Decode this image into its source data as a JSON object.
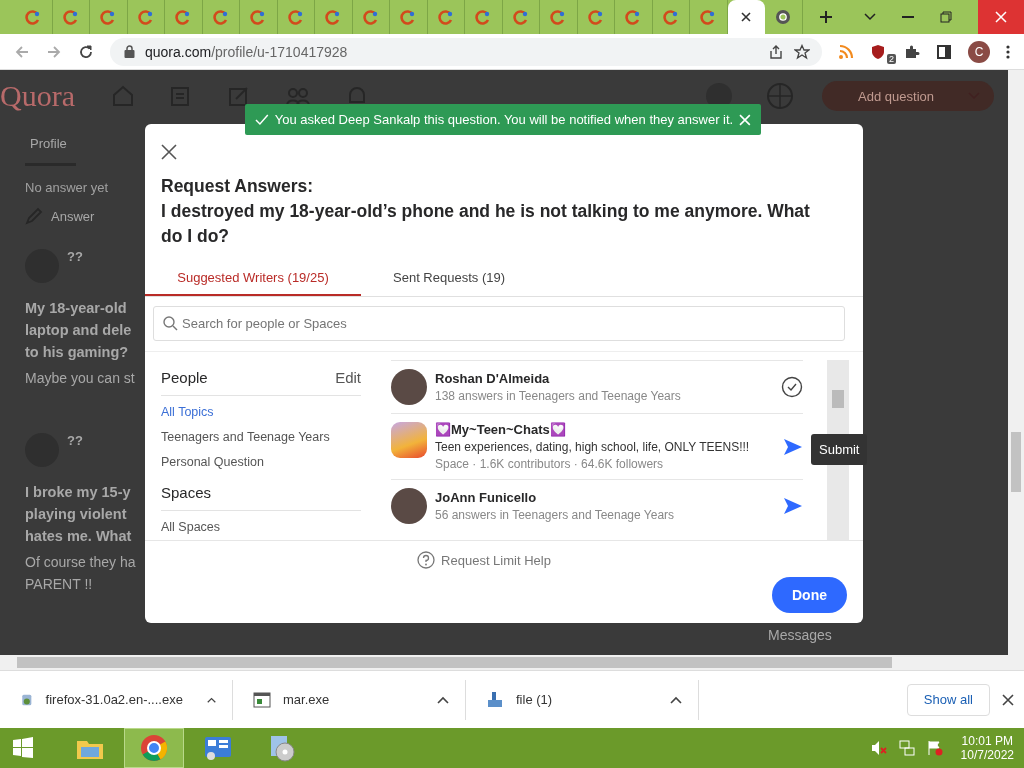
{
  "browser": {
    "tabs": [
      {
        "kind": "quora",
        "selected": false
      },
      {
        "kind": "quora",
        "selected": false
      },
      {
        "kind": "quora",
        "selected": false
      },
      {
        "kind": "quora",
        "selected": false
      },
      {
        "kind": "quora",
        "selected": false
      },
      {
        "kind": "quora",
        "selected": false
      },
      {
        "kind": "quora",
        "selected": false
      },
      {
        "kind": "quora",
        "selected": false
      },
      {
        "kind": "quora",
        "selected": false
      },
      {
        "kind": "quora",
        "selected": false
      },
      {
        "kind": "quora",
        "selected": false
      },
      {
        "kind": "quora",
        "selected": false
      },
      {
        "kind": "quora",
        "selected": false
      },
      {
        "kind": "quora",
        "selected": false
      },
      {
        "kind": "quora",
        "selected": false
      },
      {
        "kind": "quora",
        "selected": false
      },
      {
        "kind": "quora",
        "selected": false
      },
      {
        "kind": "quora",
        "selected": false
      },
      {
        "kind": "quora",
        "selected": false
      },
      {
        "selected": true
      },
      {
        "kind": "chrome",
        "selected": false
      }
    ],
    "url": {
      "host": "quora.com",
      "path": "/profile/u-1710417928"
    },
    "extension_badge": "2",
    "profile_initial": "C"
  },
  "page": {
    "logo": "Quora",
    "add_question": "Add question",
    "profile_tab": "Profile",
    "status": "No answer yet",
    "answer": "Answer",
    "posts": [
      {
        "author": "??",
        "title_lines": [
          "My 18-year-old",
          "laptop and dele",
          "to his gaming?"
        ],
        "snippet_lines": [
          "Maybe you can st"
        ]
      },
      {
        "author": "??",
        "title_lines": [
          "I broke my 15-y",
          "playing violent",
          "hates me. What"
        ],
        "snippet_lines": [
          "Of course they ha",
          "PARENT !!"
        ]
      }
    ],
    "messages": "Messages"
  },
  "toast": {
    "text": "You asked Deep Sankalp this question. You will be notified when they answer it."
  },
  "modal": {
    "heading": "Request Answers:",
    "question": "I destroyed my 18-year-old’s phone and he is not talking to me anymore. What do I do?",
    "tabs": [
      {
        "label": "Suggested Writers (19/25)",
        "selected": true
      },
      {
        "label": "Sent Requests (19)",
        "selected": false
      }
    ],
    "search": {
      "placeholder": "Search for people or Spaces"
    },
    "filters": {
      "people_heading": "People",
      "edit": "Edit",
      "topics": [
        {
          "label": "All Topics",
          "selected": true
        },
        {
          "label": "Teenagers and Teenage Years",
          "selected": false
        },
        {
          "label": "Personal Question",
          "selected": false
        }
      ],
      "spaces_heading": "Spaces",
      "spaces": [
        {
          "label": "All Spaces",
          "selected": false
        }
      ]
    },
    "writers": [
      {
        "kind": "person",
        "name": "Roshan D'Almeida",
        "lines": [
          "138 answers in Teenagers and Teenage Years"
        ],
        "requested": true
      },
      {
        "kind": "space",
        "name": "💟My~Teen~Chats💟",
        "lines": [
          "Teen experiences, dating, high school, life, ONLY TEENS!!!",
          "Space · 1.6K contributors · 64.6K followers"
        ],
        "requested": false
      },
      {
        "kind": "person",
        "name": "JoAnn Funicello",
        "lines": [
          "56 answers in Teenagers and Teenage Years"
        ],
        "requested": false
      }
    ],
    "tooltip": "Submit",
    "help": "Request Limit Help",
    "done": "Done"
  },
  "downloads": {
    "items": [
      {
        "kind": "installer",
        "name": "firefox-31.0a2.en-....exe"
      },
      {
        "kind": "window",
        "name": "mar.exe"
      },
      {
        "kind": "archive",
        "name": "file (1)"
      }
    ],
    "show_all": "Show all"
  },
  "taskbar": {
    "apps": [
      {
        "kind": "folder",
        "selected": false
      },
      {
        "kind": "chrome",
        "selected": true
      },
      {
        "kind": "panel",
        "selected": false
      },
      {
        "kind": "disc",
        "selected": false
      }
    ],
    "time": "10:01 PM",
    "date": "10/7/2022"
  }
}
